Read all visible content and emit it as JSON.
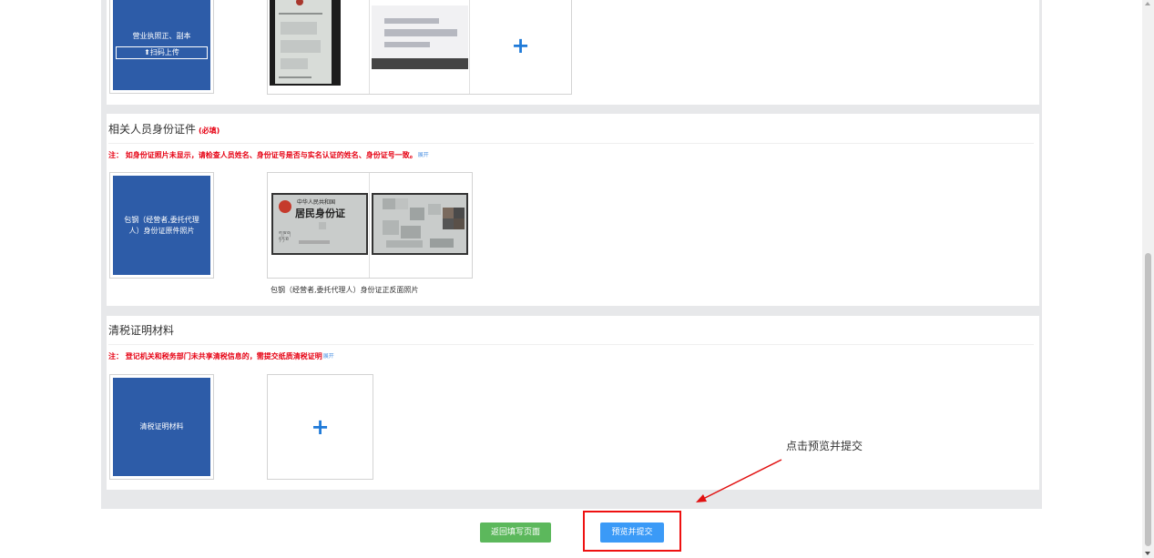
{
  "sections": {
    "business_license": {
      "card_label": "营业执照正、副本",
      "scan_button": "扫码上传",
      "add_symbol": "+"
    },
    "id_docs": {
      "title": "相关人员身份证件",
      "required": "(必填)",
      "note": "注：  如身份证照片未显示，请检查人员姓名、身份证号是否与实名认证的姓名、身份证号一致。",
      "expand": "展开",
      "card_label": "包钢（经营者,委托代理人）身份证原件照片",
      "photo_caption": "包钢（经营者,委托代理人）身份证正反面照片",
      "id_header": "中华人民共和国",
      "id_title": "居民身份证"
    },
    "tax_clearance": {
      "title": "清税证明材料",
      "note": "注：  登记机关和税务部门未共享清税信息的，需提交纸质清税证明",
      "expand": "展开",
      "card_label": "清税证明材料",
      "add_symbol": "+"
    }
  },
  "buttons": {
    "back": "返回填写页面",
    "submit": "预览并提交"
  },
  "annotation": {
    "text": "点击预览并提交",
    "color": "#e11111"
  },
  "colors": {
    "card_blue": "#2d5ca8",
    "required_red": "#e60012",
    "back_green": "#5cb85c",
    "submit_blue": "#3b9af7",
    "plus_blue": "#1f7ad8"
  },
  "icons": {
    "scan": "upload-icon",
    "add": "plus-icon"
  }
}
